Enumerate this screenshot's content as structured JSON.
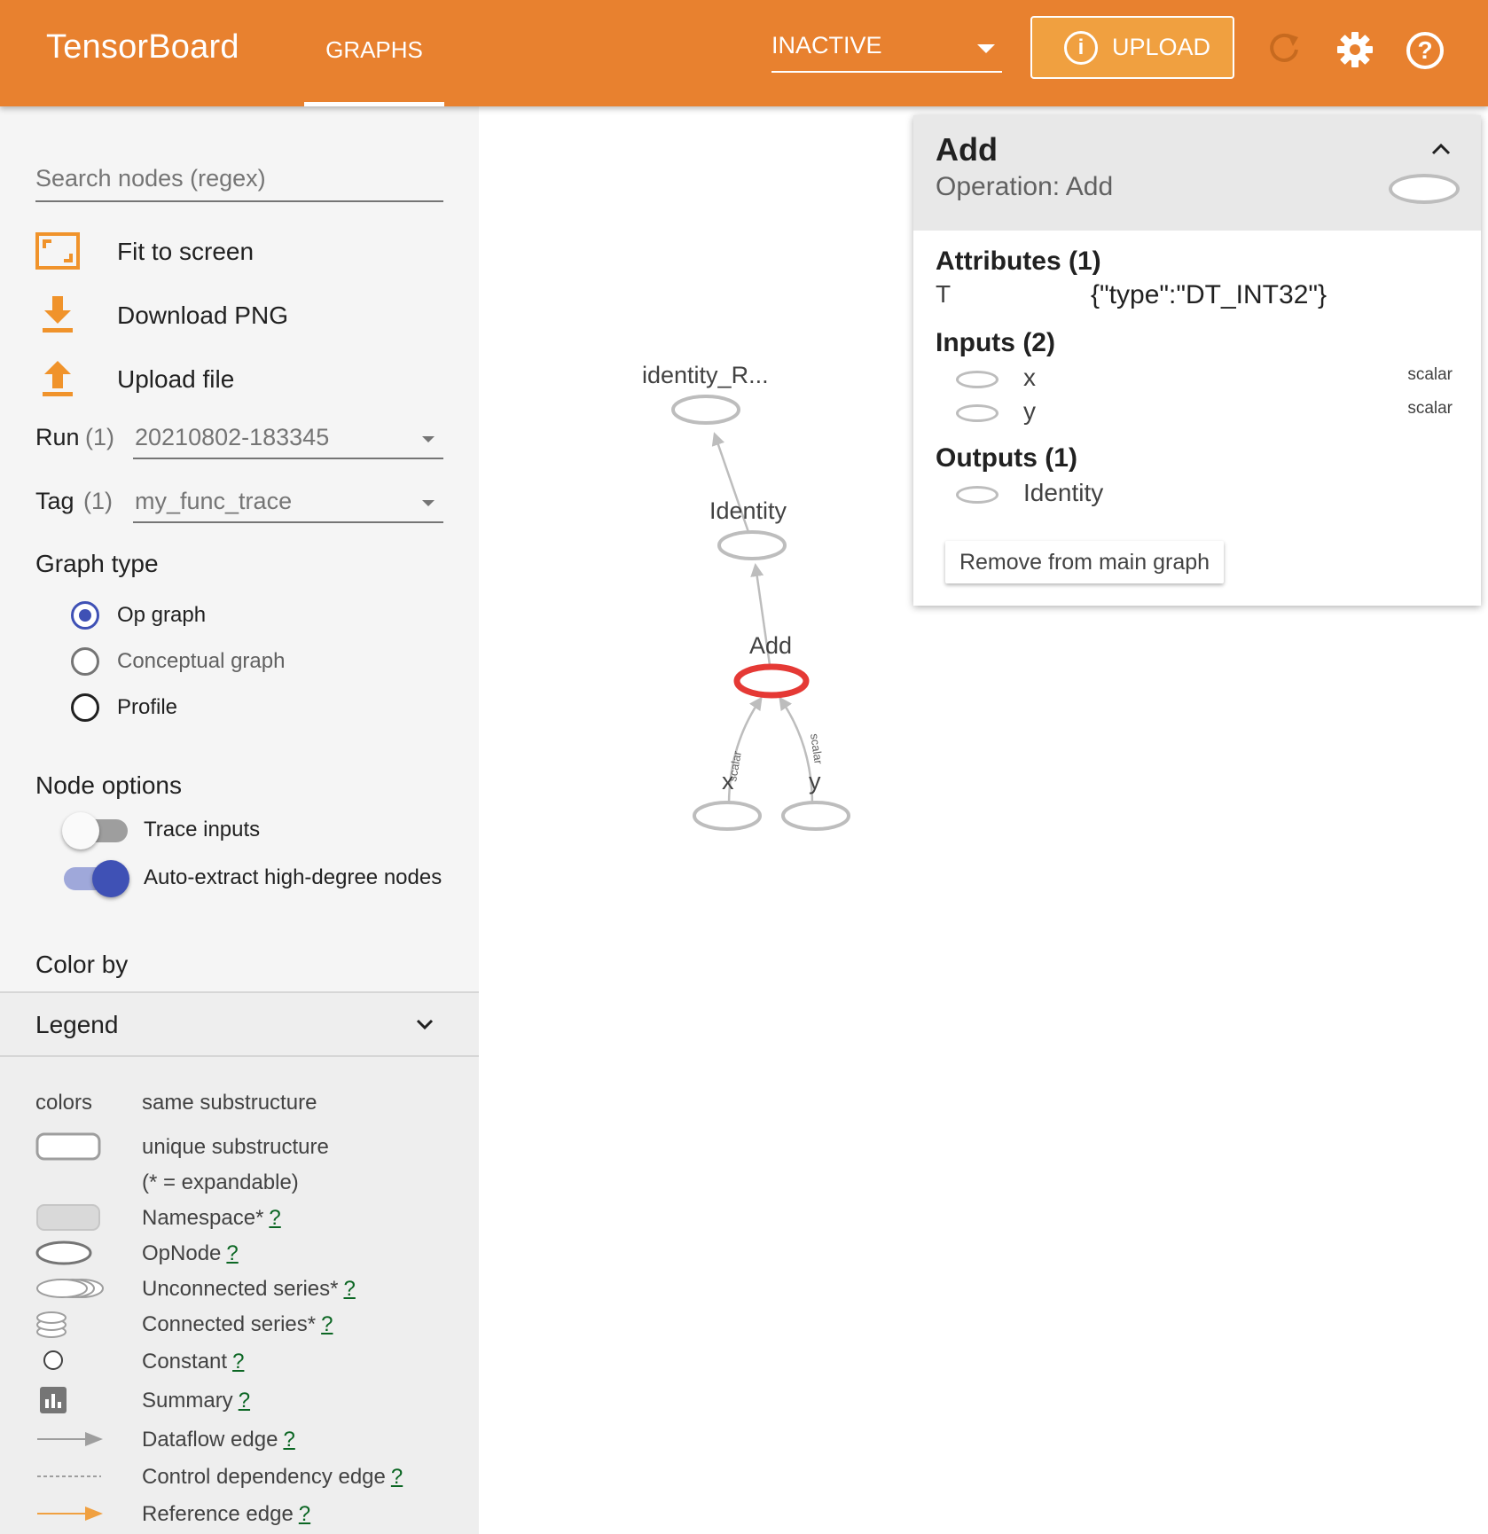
{
  "header": {
    "brand": "TensorBoard",
    "tab": "GRAPHS",
    "status": "INACTIVE",
    "upload_label": "UPLOAD",
    "accent_color": "#e8812f"
  },
  "sidebar": {
    "search_placeholder": "Search nodes (regex)",
    "actions": [
      {
        "label": "Fit to screen",
        "icon": "fit-to-screen-icon"
      },
      {
        "label": "Download PNG",
        "icon": "download-icon"
      },
      {
        "label": "Upload file",
        "icon": "upload-icon"
      }
    ],
    "run": {
      "label": "Run",
      "count": "(1)",
      "value": "20210802-183345"
    },
    "tag": {
      "label": "Tag",
      "count": "(1)",
      "value": "my_func_trace"
    },
    "graph_type": {
      "title": "Graph type",
      "options": [
        {
          "label": "Op graph",
          "selected": true
        },
        {
          "label": "Conceptual graph",
          "selected": false
        },
        {
          "label": "Profile",
          "selected": false
        }
      ]
    },
    "node_options": {
      "title": "Node options",
      "toggles": [
        {
          "label": "Trace inputs",
          "on": false
        },
        {
          "label": "Auto-extract high-degree nodes",
          "on": true
        }
      ]
    },
    "color_by": "Color by",
    "legend": {
      "title": "Legend",
      "colors_label": "colors",
      "colors_text": "same substructure",
      "rows": [
        {
          "text": "unique substructure",
          "help": ""
        },
        {
          "text": "(* = expandable)",
          "help": ""
        },
        {
          "text": "Namespace*",
          "help": "?"
        },
        {
          "text": "OpNode",
          "help": "?"
        },
        {
          "text": "Unconnected series*",
          "help": "?"
        },
        {
          "text": "Connected series*",
          "help": "?"
        },
        {
          "text": "Constant",
          "help": "?"
        },
        {
          "text": "Summary",
          "help": "?"
        },
        {
          "text": "Dataflow edge",
          "help": "?"
        },
        {
          "text": "Control dependency edge",
          "help": "?"
        },
        {
          "text": "Reference edge",
          "help": "?"
        }
      ]
    }
  },
  "graph": {
    "nodes": [
      {
        "label": "identity_R..."
      },
      {
        "label": "Identity"
      },
      {
        "label": "Add",
        "selected": true
      },
      {
        "label": "x"
      },
      {
        "label": "y"
      }
    ],
    "edge_label": "scalar",
    "selected_color": "#e53935"
  },
  "info_card": {
    "title": "Add",
    "subtitle": "Operation: Add",
    "attributes_title": "Attributes (1)",
    "attributes": [
      {
        "key": "T",
        "value": "{\"type\":\"DT_INT32\"}"
      }
    ],
    "inputs_title": "Inputs (2)",
    "inputs": [
      {
        "name": "x",
        "type": "scalar"
      },
      {
        "name": "y",
        "type": "scalar"
      }
    ],
    "outputs_title": "Outputs (1)",
    "outputs": [
      {
        "name": "Identity"
      }
    ],
    "remove_label": "Remove from main graph"
  }
}
